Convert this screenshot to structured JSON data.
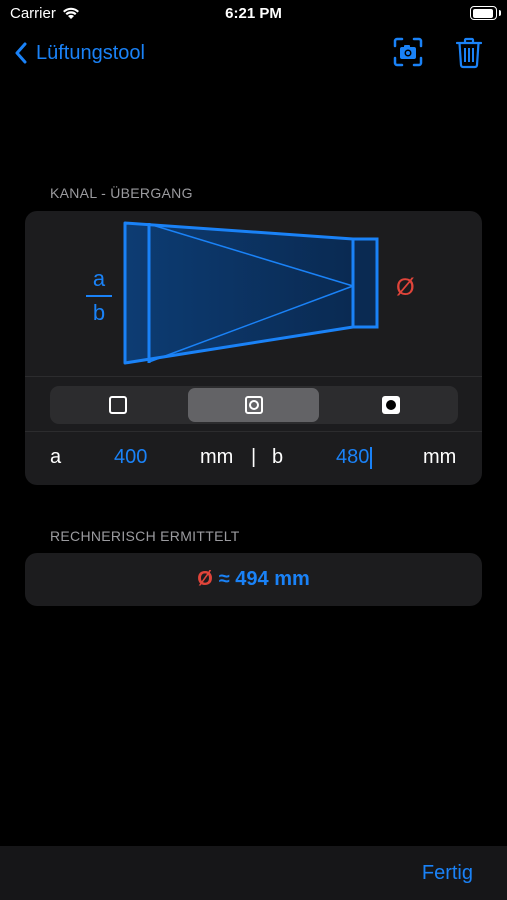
{
  "status": {
    "carrier": "Carrier",
    "time": "6:21 PM"
  },
  "nav": {
    "back_label": "Lüftungstool"
  },
  "section1": {
    "title": "KANAL - ÜBERGANG"
  },
  "diagram": {
    "fraction_top": "a",
    "fraction_bottom": "b",
    "diameter_symbol": "Ø"
  },
  "shape_segments": {
    "options": [
      "square-shape",
      "circle-in-square-shape",
      "filled-circle-shape"
    ],
    "selected_index": 1
  },
  "inputs": {
    "a_label": "a",
    "a_value": "400",
    "a_unit": "mm",
    "separator": "|",
    "b_label": "b",
    "b_value": "480",
    "b_unit": "mm"
  },
  "section2": {
    "title": "RECHNERISCH ERMITTELT"
  },
  "result": {
    "symbol": "Ø",
    "text": "≈ 494 mm"
  },
  "toolbar": {
    "done_label": "Fertig"
  },
  "colors": {
    "accent": "#1a82f7",
    "diameter": "#e0443a",
    "card": "#1c1c1e"
  }
}
